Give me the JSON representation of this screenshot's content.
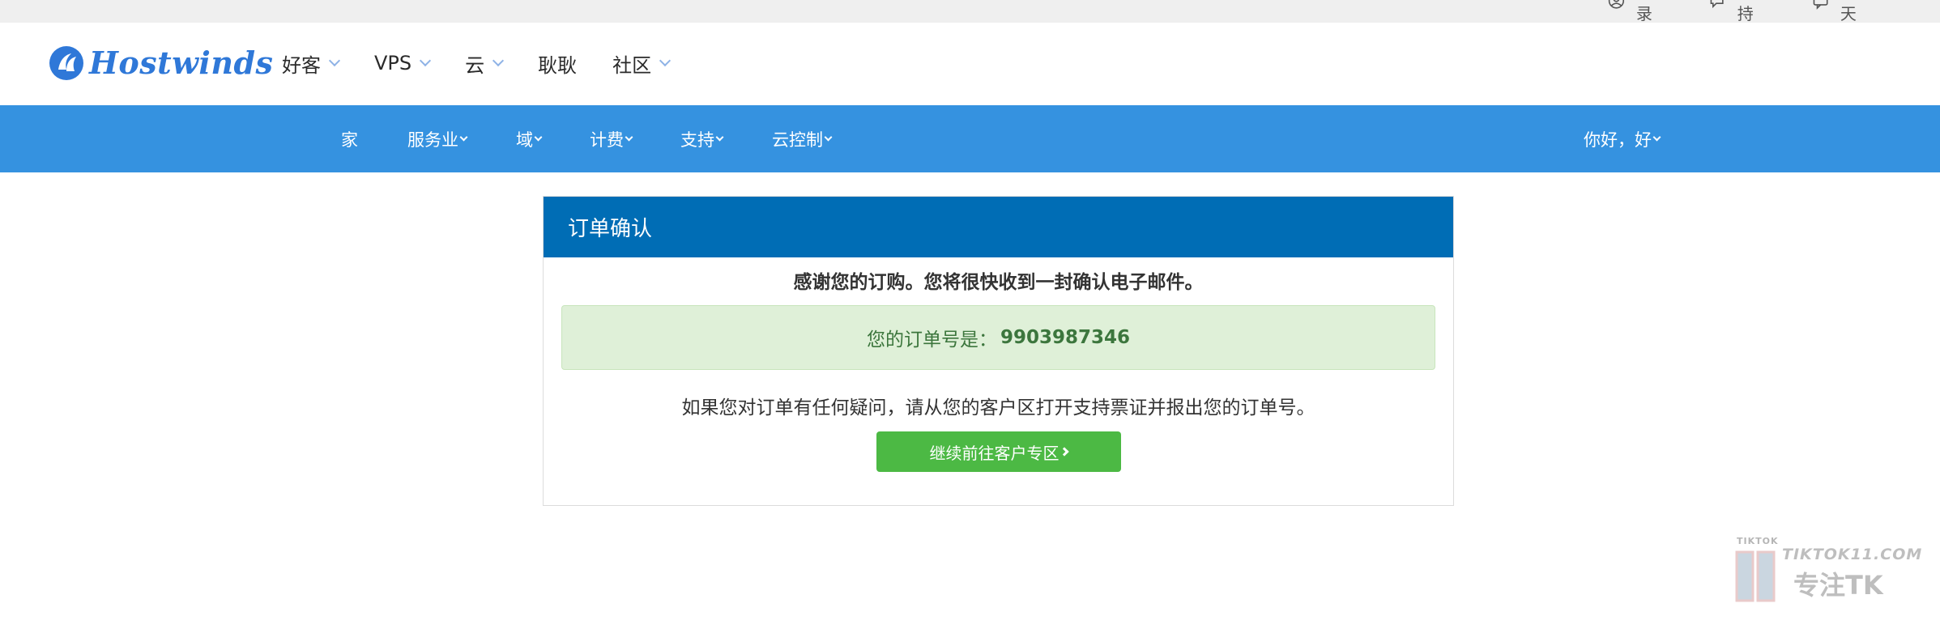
{
  "top_bar": {
    "links": [
      {
        "icon": "user-icon",
        "label": "登录"
      },
      {
        "icon": "chat-icon",
        "label": "支持"
      },
      {
        "icon": "message-icon",
        "label": "在线聊天"
      }
    ]
  },
  "header": {
    "logo_text": "Hostwinds",
    "nav": [
      {
        "label": "好客",
        "has_dropdown": true
      },
      {
        "label": "VPS",
        "has_dropdown": true
      },
      {
        "label": "云",
        "has_dropdown": true
      },
      {
        "label": "耿耿",
        "has_dropdown": false
      },
      {
        "label": "社区",
        "has_dropdown": true
      }
    ]
  },
  "subnav": {
    "items": [
      {
        "label": "家",
        "has_dropdown": false
      },
      {
        "label": "服务业",
        "has_dropdown": true
      },
      {
        "label": "域",
        "has_dropdown": true
      },
      {
        "label": "计费",
        "has_dropdown": true
      },
      {
        "label": "支持",
        "has_dropdown": true
      },
      {
        "label": "云控制",
        "has_dropdown": true
      }
    ],
    "greeting": "你好，好"
  },
  "order": {
    "title": "订单确认",
    "thanks": "感谢您的订购。您将很快收到一封确认电子邮件。",
    "order_number_label": "您的订单号是：",
    "order_number": "9903987346",
    "help_text": "如果您对订单有任何疑问，请从您的客户区打开支持票证并报出您的订单号。",
    "cta_label": "继续前往客户专区"
  },
  "watermark": {
    "small": "TIKTOK",
    "domain": "TIKTOK11.COM",
    "tag": "专注TK"
  },
  "colors": {
    "brand_blue": "#2f78d8",
    "subnav_blue": "#3592e0",
    "card_header": "#006db5",
    "success_bg": "#dff0d8",
    "success_text": "#3c763d",
    "cta_green": "#4cb944"
  }
}
